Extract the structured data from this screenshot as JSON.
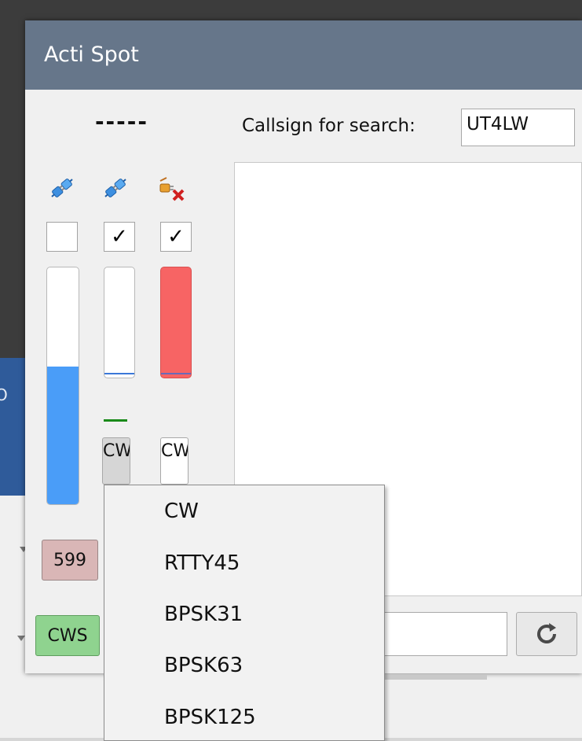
{
  "window": {
    "title": "Acti Spot"
  },
  "background": {
    "partial_label": "O"
  },
  "header": {
    "callsign_display": "-----",
    "search_label": "Callsign for search:",
    "search_value": "UT4LW"
  },
  "channels": [
    {
      "icon": "plug-connected-icon",
      "checked": false,
      "level": 0.7,
      "mode_label": ""
    },
    {
      "icon": "plug-connected-icon",
      "checked": true,
      "level": 0.04,
      "mode_label": "CW"
    },
    {
      "icon": "plug-disconnected-icon",
      "checked": true,
      "level": 0.04,
      "mode_label": "CW"
    }
  ],
  "checkboxes": {
    "checked_glyph": "✓"
  },
  "mode_buttons": {
    "ch2_label": "CW",
    "ch3_label": "CW"
  },
  "buttons": {
    "rst_label": "599",
    "cws_label": "CWS"
  },
  "dropdown": {
    "items": [
      "CW",
      "RTTY45",
      "BPSK31",
      "BPSK63",
      "BPSK125"
    ]
  },
  "colors": {
    "titlebar": "#66768a",
    "meter_blue": "#4a9df8",
    "meter_red": "#f76464",
    "rst_button": "#d9b6b6",
    "cws_button": "#8fd38f"
  }
}
